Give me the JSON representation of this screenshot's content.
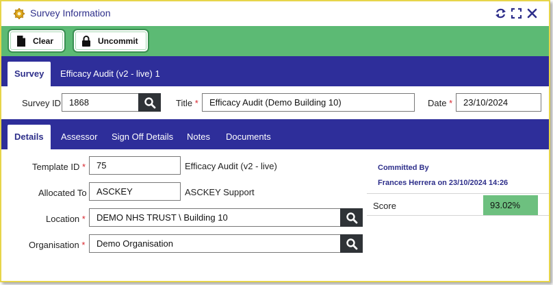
{
  "window": {
    "title": "Survey Information",
    "title_icon": "gear-icon"
  },
  "toolbar": {
    "clear_label": "Clear",
    "uncommit_label": "Uncommit"
  },
  "survey_tabs": {
    "active": "Survey",
    "other": "Efficacy Audit (v2 - live) 1"
  },
  "header": {
    "survey_id_label": "Survey ID",
    "survey_id_value": "1868",
    "title_label": "Title",
    "title_value": "Efficacy Audit (Demo Building 10)",
    "date_label": "Date",
    "date_value": "23/10/2024",
    "required_mark": "*"
  },
  "detail_tabs": [
    "Details",
    "Assessor",
    "Sign Off Details",
    "Notes",
    "Documents"
  ],
  "details": {
    "template_id_label": "Template ID",
    "template_id_value": "75",
    "template_name": "Efficacy Audit (v2 - live)",
    "allocated_to_label": "Allocated To",
    "allocated_to_value": "ASCKEY",
    "allocated_to_name": "ASCKEY Support",
    "location_label": "Location",
    "location_value": "DEMO NHS TRUST \\ Building 10",
    "organisation_label": "Organisation",
    "organisation_value": "Demo Organisation"
  },
  "commit": {
    "label": "Committed By",
    "by": "Frances Herrera on 23/10/2024 14:26",
    "score_label": "Score",
    "score_value": "93.02%"
  },
  "colors": {
    "accent": "#2e2e9a",
    "toolbar": "#5cba74",
    "score": "#6dc07f",
    "required": "#d8262e",
    "border": "#e7d54a"
  }
}
